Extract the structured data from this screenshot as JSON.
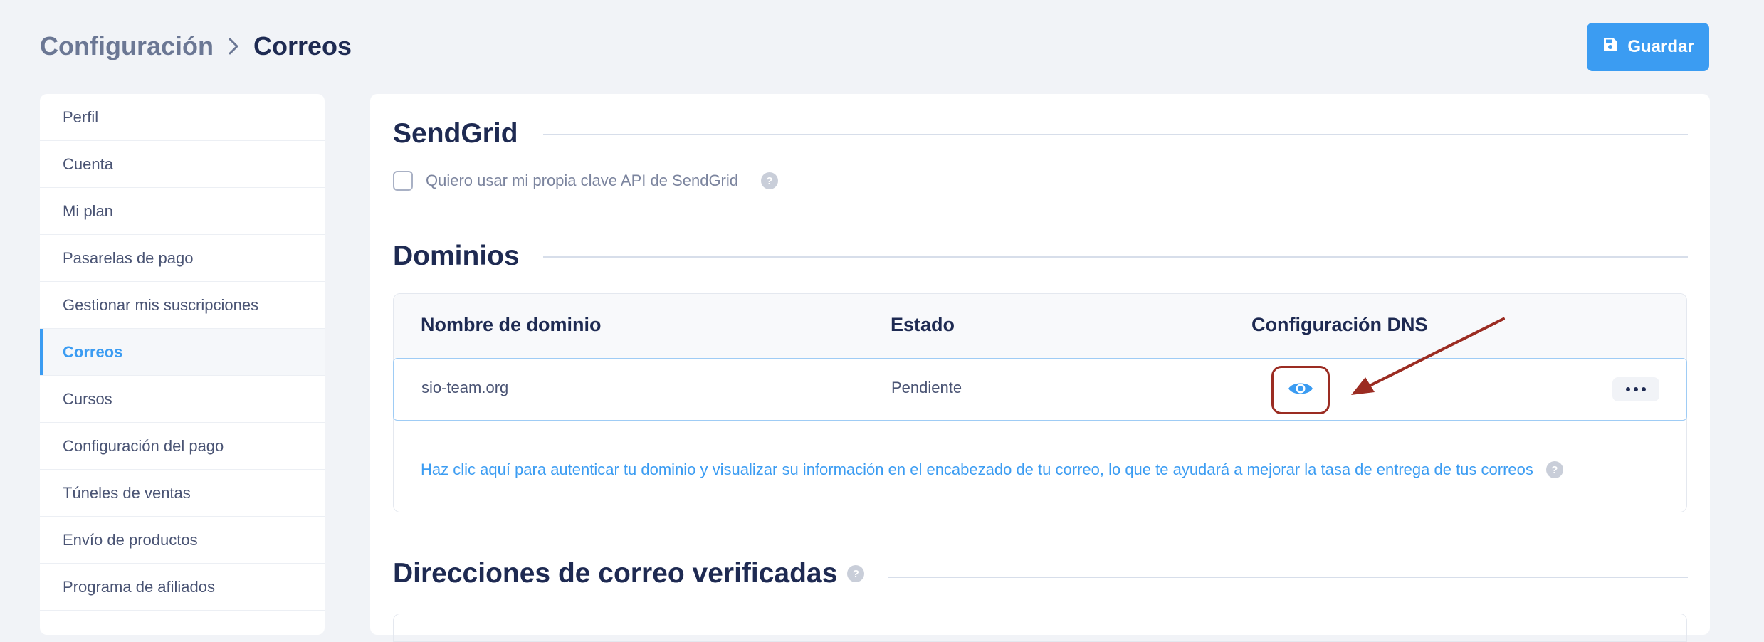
{
  "header": {
    "breadcrumb_parent": "Configuración",
    "breadcrumb_current": "Correos",
    "save_label": "Guardar"
  },
  "sidebar": {
    "items": [
      {
        "label": "Perfil",
        "active": false
      },
      {
        "label": "Cuenta",
        "active": false
      },
      {
        "label": "Mi plan",
        "active": false
      },
      {
        "label": "Pasarelas de pago",
        "active": false
      },
      {
        "label": "Gestionar mis suscripciones",
        "active": false
      },
      {
        "label": "Correos",
        "active": true
      },
      {
        "label": "Cursos",
        "active": false
      },
      {
        "label": "Configuración del pago",
        "active": false
      },
      {
        "label": "Túneles de ventas",
        "active": false
      },
      {
        "label": "Envío de productos",
        "active": false
      },
      {
        "label": "Programa de afiliados",
        "active": false
      }
    ]
  },
  "sendgrid": {
    "title": "SendGrid",
    "checkbox_label": "Quiero usar mi propia clave API de SendGrid",
    "checked": false
  },
  "domains": {
    "title": "Dominios",
    "columns": [
      "Nombre de dominio",
      "Estado",
      "Configuración DNS"
    ],
    "rows": [
      {
        "domain": "sio-team.org",
        "status": "Pendiente"
      }
    ],
    "help_link": "Haz clic aquí para autenticar tu dominio y visualizar su información en el encabezado de tu correo, lo que te ayudará a mejorar la tasa de entrega de tus correos"
  },
  "verified": {
    "title": "Direcciones de correo verificadas"
  },
  "help_glyph": "?",
  "colors": {
    "accent": "#3b9cf2",
    "title": "#1e2a52",
    "annotation": "#9b2c22"
  }
}
